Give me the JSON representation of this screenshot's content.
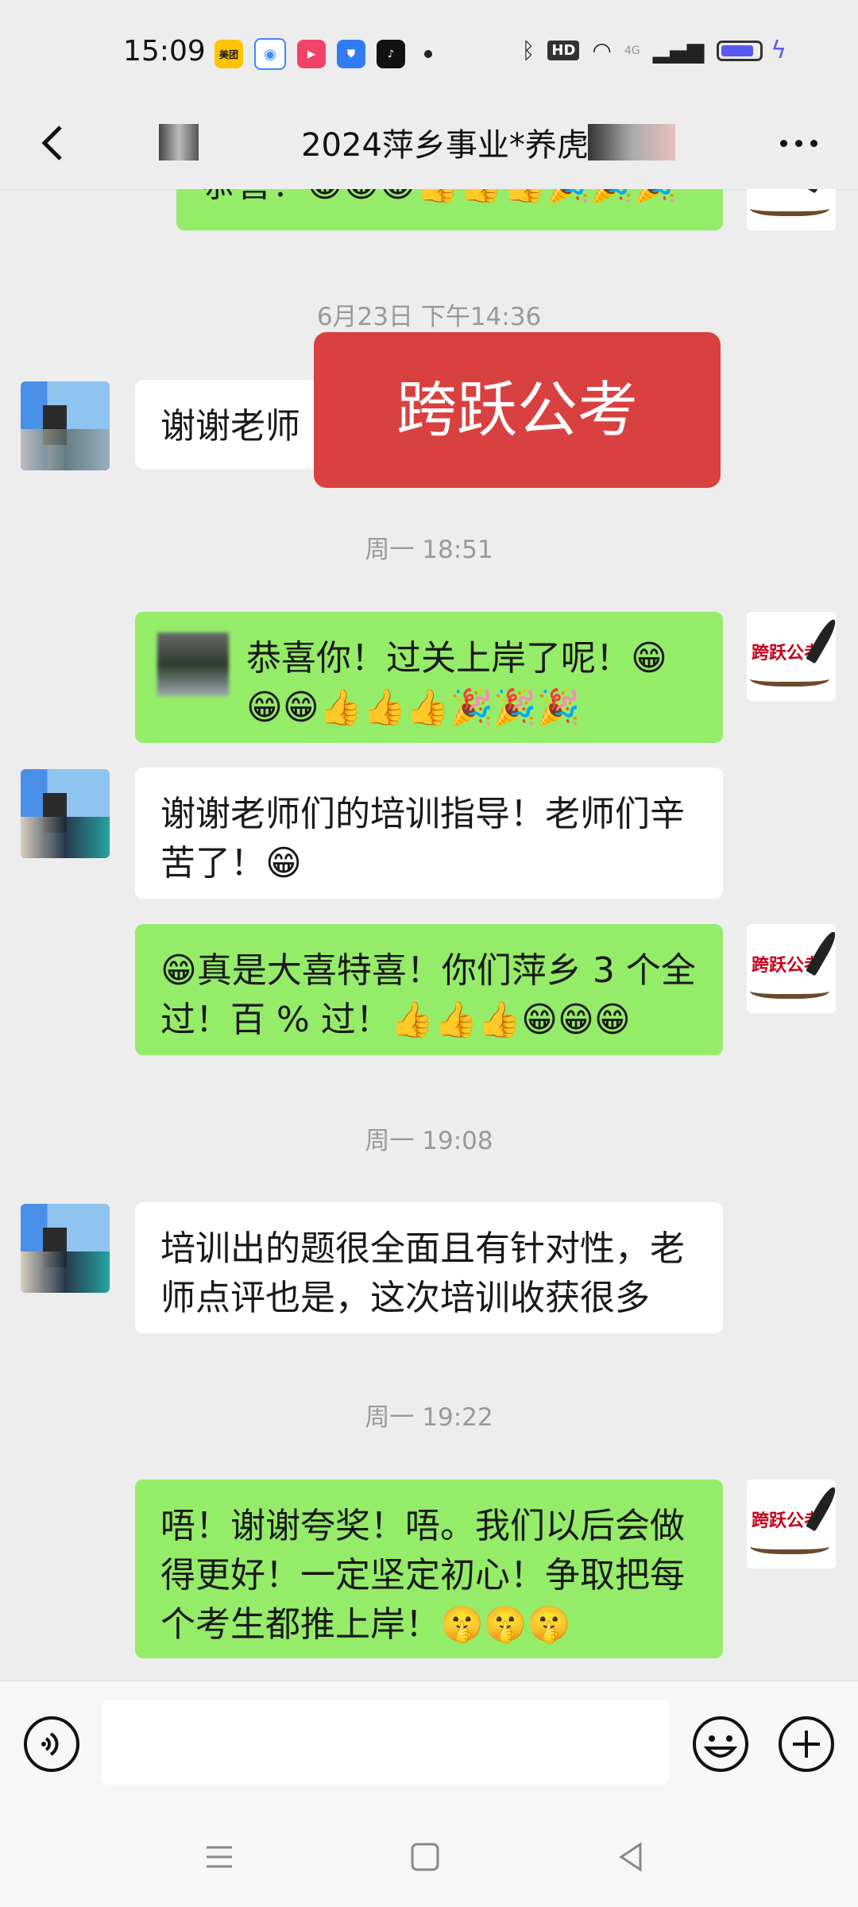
{
  "status_bar": {
    "time": "15:09",
    "apps": [
      {
        "icon": "meituan-icon",
        "label": "美团",
        "color": "#ffc300"
      },
      {
        "icon": "tencent-video-icon",
        "label": "",
        "color": "#ffffff"
      },
      {
        "icon": "play-app-icon",
        "label": "",
        "color": "#f0436a"
      },
      {
        "icon": "shield-app-icon",
        "label": "",
        "color": "#2f7cf6"
      },
      {
        "icon": "douyin-icon",
        "label": "",
        "color": "#111111"
      }
    ],
    "hd_label": "HD",
    "network": "4G"
  },
  "header": {
    "title": "2024萍乡事业*养虎",
    "back_icon": "back-arrow-icon",
    "more_icon": "more-dots-icon"
  },
  "messages": [
    {
      "type": "out",
      "text": "恭喜！😁😁😁👍👍👍🎉🎉🎉"
    },
    {
      "type": "time",
      "text": "6月23日 下午14:36"
    },
    {
      "type": "in",
      "text": "谢谢老师"
    },
    {
      "type": "banner",
      "text": "跨跃公考"
    },
    {
      "type": "time",
      "text": "周一 18:51"
    },
    {
      "type": "out",
      "text": "恭喜你！过关上岸了呢！😁😁😁👍👍👍🎉🎉🎉"
    },
    {
      "type": "in",
      "text": "谢谢老师们的培训指导！老师们辛苦了！😁"
    },
    {
      "type": "out",
      "text": "😁真是大喜特喜！你们萍乡 3 个全过！百 % 过！👍👍👍😁😁😁"
    },
    {
      "type": "time",
      "text": "周一 19:08"
    },
    {
      "type": "in",
      "text": "培训出的题很全面且有针对性，老师点评也是，这次培训收获很多"
    },
    {
      "type": "time",
      "text": "周一 19:22"
    },
    {
      "type": "out",
      "text": "唔！谢谢夸奖！唔。我们以后会做得更好！一定坚定初心！争取把每个考生都推上岸！🤫🤫🤫"
    }
  ],
  "avatar_logo_text": "跨跃公考",
  "input": {
    "placeholder": "",
    "value": ""
  },
  "colors": {
    "out_bubble": "#95ec69",
    "in_bubble": "#ffffff",
    "banner": "#d94141"
  }
}
